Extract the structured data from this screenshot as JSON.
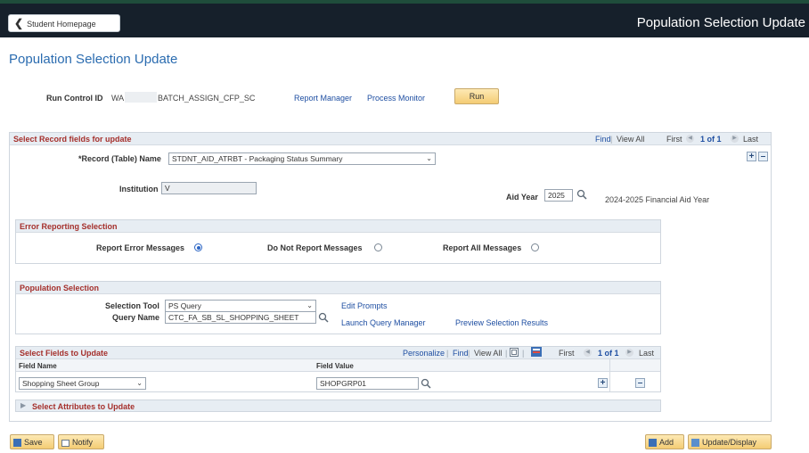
{
  "header": {
    "home_button": "Student Homepage",
    "banner_title": "Population Selection Update"
  },
  "page_title": "Population Selection Update",
  "run_control": {
    "label": "Run Control ID",
    "value_prefix": "WA",
    "value_suffix": "BATCH_ASSIGN_CFP_SC",
    "report_manager": "Report Manager",
    "process_monitor": "Process Monitor",
    "run_button": "Run"
  },
  "record_section": {
    "title": "Select Record fields for update",
    "find": "Find",
    "view_all": "View All",
    "first": "First",
    "count": "1 of 1",
    "last": "Last",
    "record_label": "*Record (Table) Name",
    "record_value": "STDNT_AID_ATRBT - Packaging Status Summary",
    "institution_label": "Institution",
    "institution_value": "V",
    "aid_year_label": "Aid Year",
    "aid_year_value": "2025",
    "aid_year_desc": "2024-2025 Financial Aid Year"
  },
  "error_section": {
    "title": "Error Reporting Selection",
    "opt1": "Report Error Messages",
    "opt2": "Do Not Report Messages",
    "opt3": "Report All Messages"
  },
  "population_section": {
    "title": "Population Selection",
    "tool_label": "Selection Tool",
    "tool_value": "PS Query",
    "query_label": "Query Name",
    "query_value": "CTC_FA_SB_SL_SHOPPING_SHEET",
    "edit_prompts": "Edit Prompts",
    "launch_qm": "Launch Query Manager",
    "preview": "Preview Selection Results"
  },
  "fields_section": {
    "title": "Select Fields to Update",
    "personalize": "Personalize",
    "find": "Find",
    "view_all": "View All",
    "first": "First",
    "count": "1 of 1",
    "last": "Last",
    "col_field_name": "Field Name",
    "col_field_value": "Field Value",
    "row_field_name": "Shopping Sheet Group",
    "row_field_value": "SHOPGRP01"
  },
  "attributes_section": {
    "title": "Select Attributes to Update"
  },
  "footer": {
    "save": "Save",
    "notify": "Notify",
    "add": "Add",
    "update_display": "Update/Display"
  },
  "colors": {
    "banner_bg": "#16202b",
    "section_title": "#a5302c",
    "link": "#1f4fa2",
    "page_title": "#2b6cb0",
    "button_bg": "#f4cc74"
  },
  "icons": [
    "chevron-left-icon",
    "search-icon",
    "radio-icon",
    "add-row-icon",
    "delete-row-icon",
    "prev-arrow-icon",
    "next-arrow-icon",
    "zoom-icon",
    "download-icon",
    "save-icon",
    "notify-icon",
    "add-icon",
    "update-display-icon",
    "expand-triangle-icon"
  ]
}
